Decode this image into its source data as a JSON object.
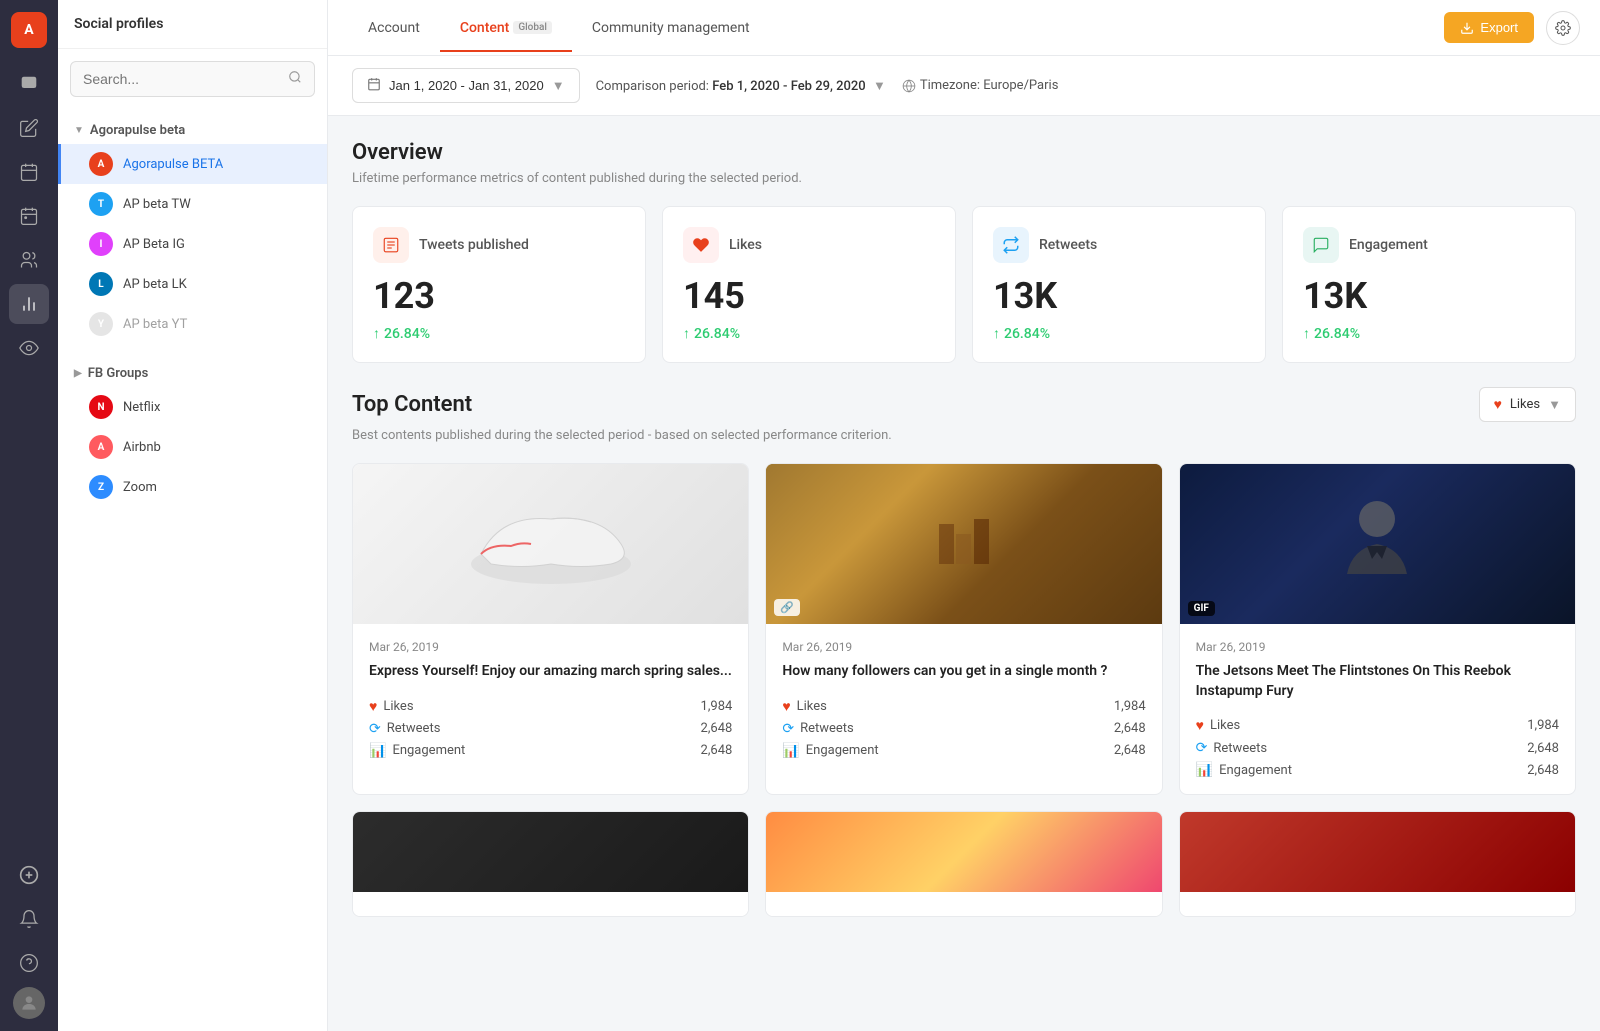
{
  "app": {
    "logo": "A",
    "sidebar_title": "Social profiles"
  },
  "nav": {
    "icons": [
      {
        "name": "inbox-icon",
        "symbol": "✉",
        "active": false
      },
      {
        "name": "compose-icon",
        "symbol": "✏",
        "active": false
      },
      {
        "name": "calendar-icon",
        "symbol": "📅",
        "active": false
      },
      {
        "name": "reports-icon",
        "symbol": "📊",
        "active": true
      },
      {
        "name": "users-icon",
        "symbol": "👥",
        "active": false
      },
      {
        "name": "listening-icon",
        "symbol": "👂",
        "active": false
      },
      {
        "name": "power-icon",
        "symbol": "⚡",
        "active": false
      }
    ]
  },
  "sidebar": {
    "search_placeholder": "Search...",
    "groups": [
      {
        "name": "Agorapulse beta",
        "items": [
          {
            "label": "Agorapulse BETA",
            "color": "#e8401c",
            "active": true
          },
          {
            "label": "AP beta TW",
            "color": "#1da1f2"
          },
          {
            "label": "AP Beta IG",
            "color": "#e040fb"
          },
          {
            "label": "AP beta LK",
            "color": "#0077b5"
          },
          {
            "label": "AP beta YT",
            "color": "#ff0000",
            "disabled": true
          }
        ]
      },
      {
        "name": "FB Groups",
        "items": [
          {
            "label": "Netflix",
            "color": "#e50914"
          },
          {
            "label": "Airbnb",
            "color": "#ff5a5f"
          },
          {
            "label": "Zoom",
            "color": "#2d8cff"
          }
        ]
      }
    ]
  },
  "topnav": {
    "tabs": [
      {
        "label": "Account",
        "active": false
      },
      {
        "label": "Content",
        "badge": "Global",
        "active": true
      },
      {
        "label": "Community management",
        "active": false
      }
    ],
    "export_label": "Export",
    "settings_icon": "⚙"
  },
  "filters": {
    "date_range": "Jan 1, 2020 - Jan 31, 2020",
    "comparison_label": "Comparison period:",
    "comparison_date": "Feb 1, 2020 - Feb 29, 2020",
    "timezone_label": "Timezone: Europe/Paris"
  },
  "overview": {
    "title": "Overview",
    "subtitle": "Lifetime performance metrics of content published during the selected period.",
    "stats": [
      {
        "label": "Tweets published",
        "value": "123",
        "change": "26.84%",
        "icon": "📋",
        "icon_class": "orange"
      },
      {
        "label": "Likes",
        "value": "145",
        "change": "26.84%",
        "icon": "❤",
        "icon_class": "red"
      },
      {
        "label": "Retweets",
        "value": "13K",
        "change": "26.84%",
        "icon": "🔁",
        "icon_class": "blue"
      },
      {
        "label": "Engagement",
        "value": "13K",
        "change": "26.84%",
        "icon": "💬",
        "icon_class": "teal"
      }
    ]
  },
  "top_content": {
    "title": "Top Content",
    "subtitle": "Best contents published during the selected period - based on selected performance criterion.",
    "filter_label": "Likes",
    "cards": [
      {
        "date": "Mar 26, 2019",
        "title": "Express Yourself! Enjoy our amazing march spring sales...",
        "likes": "1,984",
        "retweets": "2,648",
        "engagement": "2,648",
        "img_type": "shoe",
        "badge_type": "image"
      },
      {
        "date": "Mar 26, 2019",
        "title": "How many followers can you get in a single month ?",
        "likes": "1,984",
        "retweets": "2,648",
        "engagement": "2,648",
        "img_type": "market",
        "badge_type": "link"
      },
      {
        "date": "Mar 26, 2019",
        "title": "The Jetsons Meet The Flintstones On This Reebok Instapump Fury",
        "likes": "1,984",
        "retweets": "2,648",
        "engagement": "2,648",
        "img_type": "person",
        "badge_type": "gif"
      }
    ],
    "cards_row2": [
      {
        "date": "",
        "title": "",
        "img_type": "dark1"
      },
      {
        "date": "",
        "title": "",
        "img_type": "colorful"
      },
      {
        "date": "",
        "title": "",
        "img_type": "red"
      }
    ],
    "stat_labels": {
      "likes": "Likes",
      "retweets": "Retweets",
      "engagement": "Engagement"
    }
  }
}
